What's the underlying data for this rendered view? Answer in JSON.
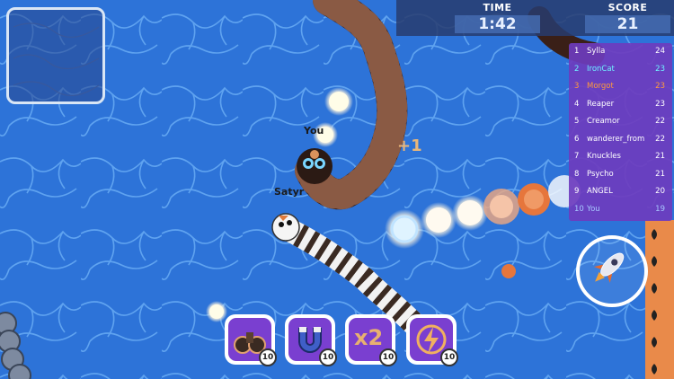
{
  "hud": {
    "time_label": "TIME",
    "time_value": "1:42",
    "score_label": "SCORE",
    "score_value": "21"
  },
  "leaderboard": [
    {
      "rank": "1",
      "name": "Sylla",
      "score": "24",
      "color": "#ffffff"
    },
    {
      "rank": "2",
      "name": "IronCat",
      "score": "23",
      "color": "#6ff0ff"
    },
    {
      "rank": "3",
      "name": "Morgot",
      "score": "23",
      "color": "#ff9a3c"
    },
    {
      "rank": "4",
      "name": "Reaper",
      "score": "23",
      "color": "#ffffff"
    },
    {
      "rank": "5",
      "name": "Creamor",
      "score": "22",
      "color": "#ffffff"
    },
    {
      "rank": "6",
      "name": "wanderer_from",
      "score": "22",
      "color": "#ffffff"
    },
    {
      "rank": "7",
      "name": "Knuckles",
      "score": "21",
      "color": "#ffffff"
    },
    {
      "rank": "8",
      "name": "Psycho",
      "score": "21",
      "color": "#ffffff"
    },
    {
      "rank": "9",
      "name": "ANGEL",
      "score": "20",
      "color": "#ffffff"
    },
    {
      "rank": "10",
      "name": "You",
      "score": "19",
      "color": "#a8c8ff"
    }
  ],
  "players": {
    "you_label": "You",
    "other_label": "Satyr",
    "pickup_text": "+1"
  },
  "powerups": [
    {
      "name": "binoculars-icon",
      "count": "10"
    },
    {
      "name": "magnet-icon",
      "count": "10"
    },
    {
      "name": "x2-multiplier-icon",
      "count": "10",
      "label": "x2"
    },
    {
      "name": "lightning-icon",
      "count": "10"
    }
  ],
  "boost": {
    "icon": "rocket-icon"
  },
  "colors": {
    "water": "#2a6fd6",
    "panel": "#6e3cbe",
    "powerup": "#7a3fd0"
  }
}
